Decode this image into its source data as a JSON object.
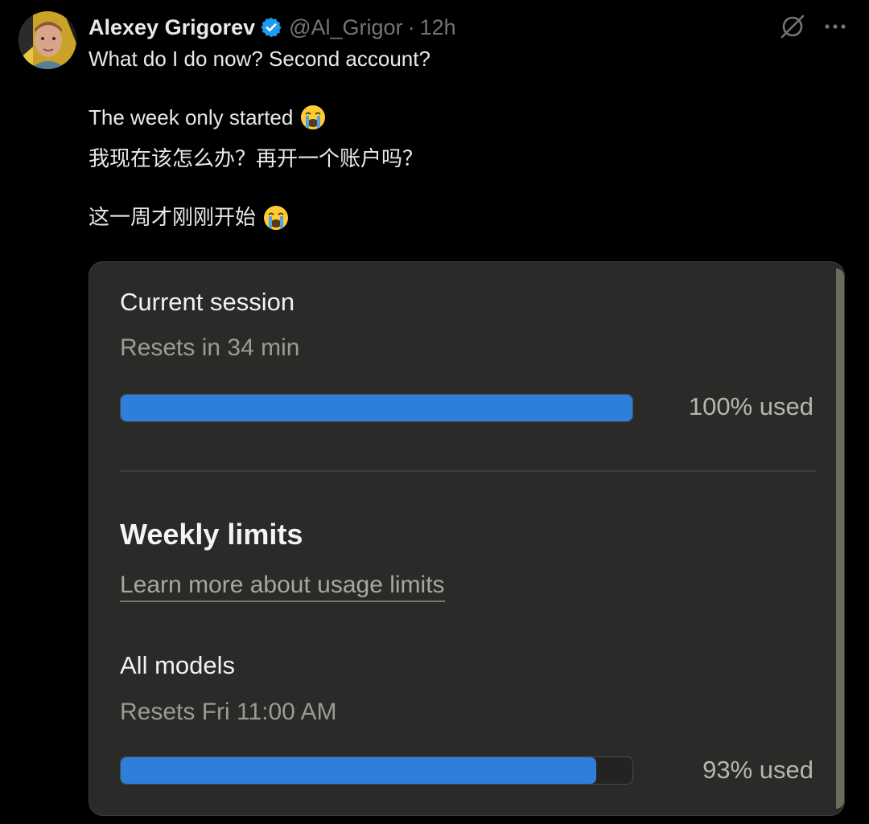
{
  "author": {
    "name": "Alexey Grigorev",
    "handle": "@Al_Grigor",
    "separator": "·",
    "time": "12h"
  },
  "icons": {
    "verified": "verified-badge-icon",
    "grok": "grok-icon",
    "more": "more-icon",
    "emoji": "loudly-crying-face-emoji"
  },
  "tweet": {
    "line1": "What do I do now? Second account?",
    "line2": "The week only started",
    "line3": "我现在该怎么办？再开一个账户吗？",
    "line4": "这一周才刚刚开始"
  },
  "card": {
    "current_session": {
      "title": "Current session",
      "reset": "Resets in 34 min",
      "usage_label": "100% used",
      "usage_fraction": 1.0
    },
    "weekly": {
      "title": "Weekly limits",
      "link": "Learn more about usage limits",
      "all_models": {
        "title": "All models",
        "reset": "Resets Fri 11:00 AM",
        "usage_label": "93% used",
        "usage_fraction": 0.93
      }
    }
  },
  "colors": {
    "background": "#000000",
    "text": "#e7e9ea",
    "muted": "#71767b",
    "verified": "#1d9bf0",
    "card": "#2a2a29",
    "bar_fill": "#2d7fd9"
  }
}
